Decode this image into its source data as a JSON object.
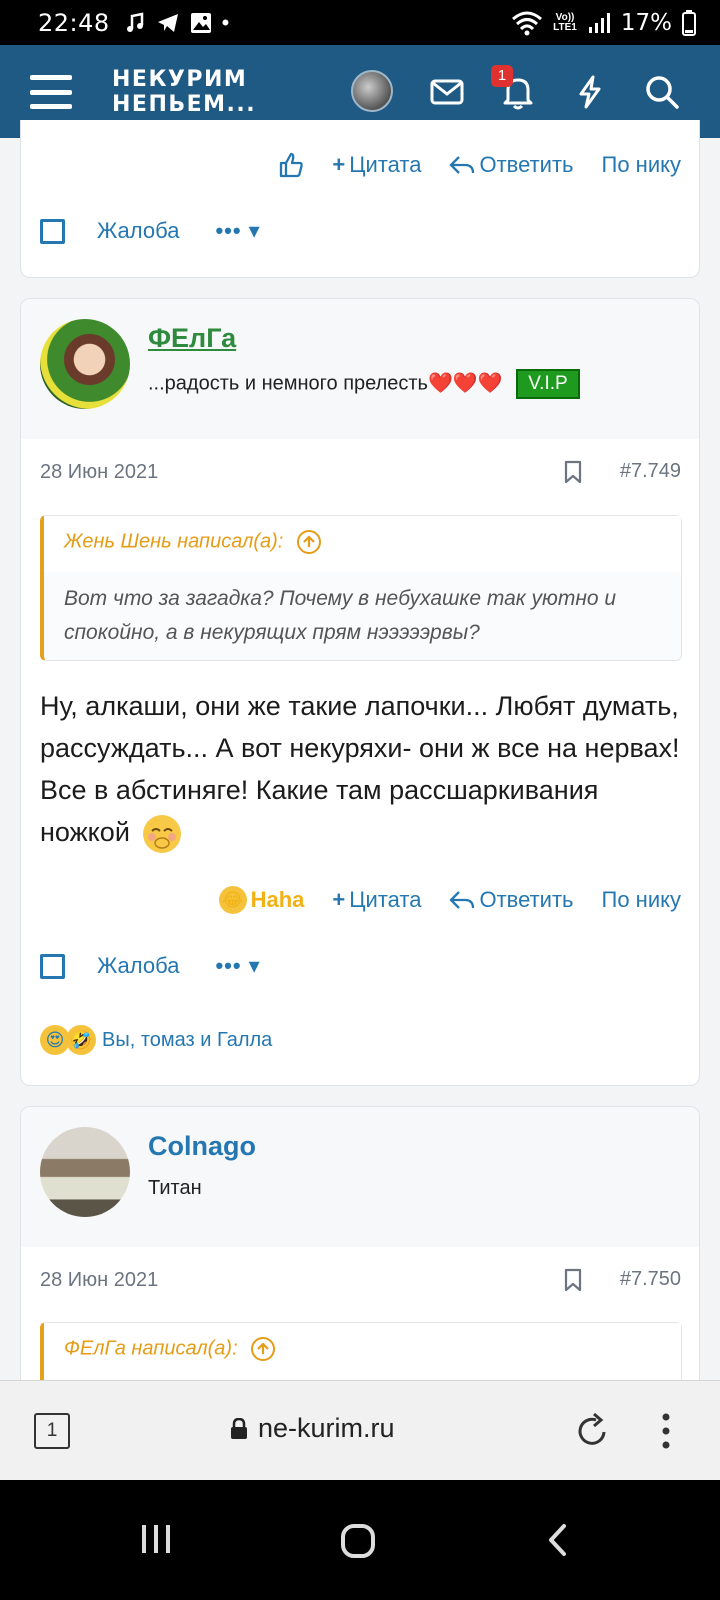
{
  "status_bar": {
    "time": "22:48",
    "battery": "17%",
    "lte_top": "Vo))",
    "lte_bottom": "LTE1"
  },
  "header": {
    "logo_line1": "НЕКУРИМ",
    "logo_line2": "НЕПЬЕМ...",
    "notification_count": "1"
  },
  "prev_post": {
    "actions": {
      "quote": "Цитата",
      "reply": "Ответить",
      "by_nick": "По нику"
    },
    "report": "Жалоба",
    "more": "•••"
  },
  "posts": [
    {
      "username": "ФЕлГа",
      "user_title": "...радость и немного прелесть❤️❤️❤️",
      "badge": "V.I.P",
      "date": "28 Июн 2021",
      "number": "#7.749",
      "quote_author": "Жень Шень написал(а):",
      "quote_text": "Вот что за загадка? Почему в небухашке так уютно и спокойно, а в некурящих прям нэээээрвы?",
      "text": "Ну, алкаши, они же такие лапочки... Любят думать, рассуждать... А вот некуряхи- они ж все на нервах! Все в абстиняге! Какие там рассшаркивания ножкой",
      "reaction_label": "Haha",
      "actions": {
        "quote": "Цитата",
        "reply": "Ответить",
        "by_nick": "По нику"
      },
      "report": "Жалоба",
      "more": "•••",
      "reacted_by": "Вы, томаз и Галла"
    },
    {
      "username": "Colnago",
      "user_title": "Титан",
      "date": "28 Июн 2021",
      "number": "#7.750",
      "quote_author": "ФЕлГа написал(а):"
    }
  ],
  "browser": {
    "tab_count": "1",
    "url": "ne-kurim.ru"
  },
  "colors": {
    "header_bg": "#1f5a85",
    "link": "#2577b1",
    "quote_accent": "#e6a020",
    "vip_bg": "#1e9a1e"
  }
}
